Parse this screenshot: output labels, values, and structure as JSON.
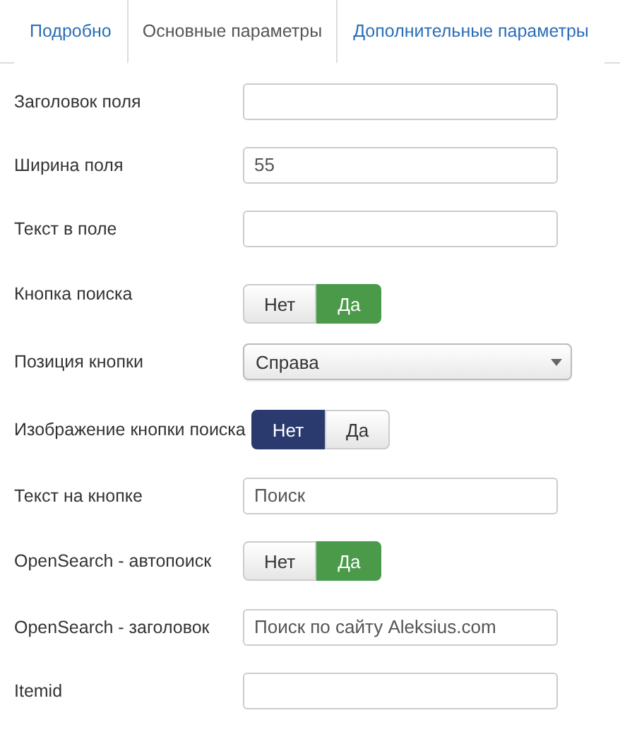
{
  "tabs": [
    {
      "label": "Подробно",
      "selected": false
    },
    {
      "label": "Основные параметры",
      "selected": true
    },
    {
      "label": "Дополнительные параметры",
      "selected": false
    }
  ],
  "fields": [
    {
      "kind": "text",
      "label": "Заголовок поля"
    },
    {
      "kind": "text",
      "label": "Ширина поля",
      "value": "55"
    },
    {
      "kind": "text",
      "label": "Текст в поле"
    },
    {
      "kind": "toggle",
      "label": "Кнопка поиска",
      "options": [
        {
          "label": "Нет",
          "kind": "no",
          "selected": false
        },
        {
          "label": "Да",
          "kind": "yes",
          "selected": true
        }
      ]
    },
    {
      "kind": "select",
      "label": "Позиция кнопки",
      "value": "Справа"
    },
    {
      "kind": "toggle",
      "label": "Изображение кнопки поиска",
      "options": [
        {
          "label": "Нет",
          "kind": "no",
          "selected": true
        },
        {
          "label": "Да",
          "kind": "yes",
          "selected": false
        }
      ]
    },
    {
      "kind": "text",
      "label": "Текст на кнопке",
      "value": "Поиск"
    },
    {
      "kind": "toggle",
      "label": "OpenSearch - автопоиск",
      "options": [
        {
          "label": "Нет",
          "kind": "no",
          "selected": false
        },
        {
          "label": "Да",
          "kind": "yes",
          "selected": true
        }
      ]
    },
    {
      "kind": "text",
      "label": "OpenSearch - заголовок",
      "value": "Поиск по сайту Aleksius.com"
    },
    {
      "kind": "text",
      "label": "Itemid"
    }
  ]
}
